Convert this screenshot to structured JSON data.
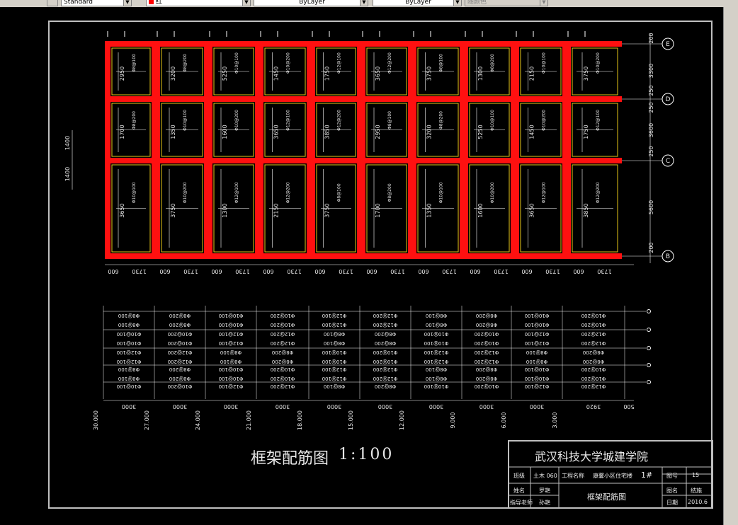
{
  "toolbar": {
    "style_combo": "Standard",
    "color_combo": "红",
    "linetype_combo": "ByLayer",
    "lineweight_combo": "ByLayer",
    "plotstyle_combo": "随颜色",
    "color_swatch": "#ff0000"
  },
  "drawing": {
    "axis_labels": [
      "E",
      "D",
      "C",
      "B"
    ],
    "spans_right": [
      "200",
      "3300",
      "250",
      "250",
      "3600",
      "250",
      "5600",
      "200"
    ],
    "row_heights_left": [
      "1400",
      "1400"
    ],
    "bottom_dims": [
      "600",
      "1730",
      "600",
      "1730",
      "600",
      "1730",
      "600",
      "1730",
      "600",
      "1730",
      "600",
      "1730",
      "600",
      "1730",
      "600",
      "1730",
      "600",
      "1730",
      "600",
      "1730"
    ],
    "inner_dims": [
      "2950",
      "3200",
      "5250",
      "1450",
      "1750",
      "3650",
      "3750",
      "1300",
      "2150",
      "3750",
      "1700",
      "1350",
      "1600",
      "3650",
      "3850"
    ],
    "rebar_labels": [
      "Φ8@100",
      "Φ8@200",
      "Φ10@100",
      "Φ10@200",
      "Φ12@100",
      "Φ12@200"
    ],
    "elevations": [
      "30.000",
      "27.000",
      "24.000",
      "21.000",
      "18.000",
      "15.000",
      "12.000",
      "9.000",
      "6.000",
      "3.000"
    ],
    "wall_dims": [
      "3000",
      "3000",
      "3000",
      "3000",
      "3000",
      "3000",
      "3000",
      "3000",
      "3000",
      "3920",
      "500"
    ],
    "scale_title": "框架配筋图",
    "scale": "1:100"
  },
  "title_block": {
    "school": "武汉科技大学城建学院",
    "class_label": "班级",
    "class_value": "土木 060",
    "project_label": "工程名称",
    "project_value": "康馨小区住宅楼",
    "building_no": "1#",
    "drawing_no_label": "图号",
    "drawing_no_value": "15",
    "name_label": "姓名",
    "name_value": "罗艳",
    "figure_name_label": "图名",
    "figure_name_value": "结施",
    "drawing_title": "框架配筋图",
    "advisor_label": "指导老师",
    "advisor_value": "孙艳",
    "date_label": "日期",
    "date_value": "2010.6"
  }
}
